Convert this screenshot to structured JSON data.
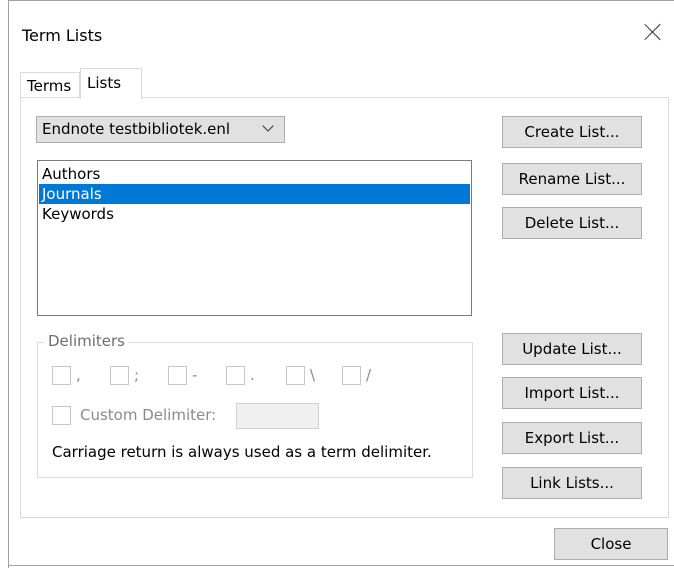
{
  "dialog": {
    "title": "Term Lists",
    "close_glyph": "close-icon"
  },
  "tabs": [
    {
      "label": "Terms",
      "selected": false
    },
    {
      "label": "Lists",
      "selected": true
    }
  ],
  "library_select": {
    "value": "Endnote testbibliotek.enl"
  },
  "lists": {
    "items": [
      "Authors",
      "Journals",
      "Keywords"
    ],
    "selected": "Journals"
  },
  "buttons": {
    "create": "Create List...",
    "rename": "Rename List...",
    "delete": "Delete List...",
    "update": "Update List...",
    "import": "Import List...",
    "export": "Export List...",
    "link": "Link Lists...",
    "close": "Close"
  },
  "delimiters": {
    "legend": "Delimiters",
    "items": [
      ",",
      ";",
      "-",
      ".",
      "\\",
      "/"
    ],
    "custom_label": "Custom Delimiter:",
    "custom_value": "",
    "note": "Carriage return is always used as a term delimiter."
  },
  "colors": {
    "selection": "#0078d7",
    "button_face": "#e1e1e1"
  }
}
